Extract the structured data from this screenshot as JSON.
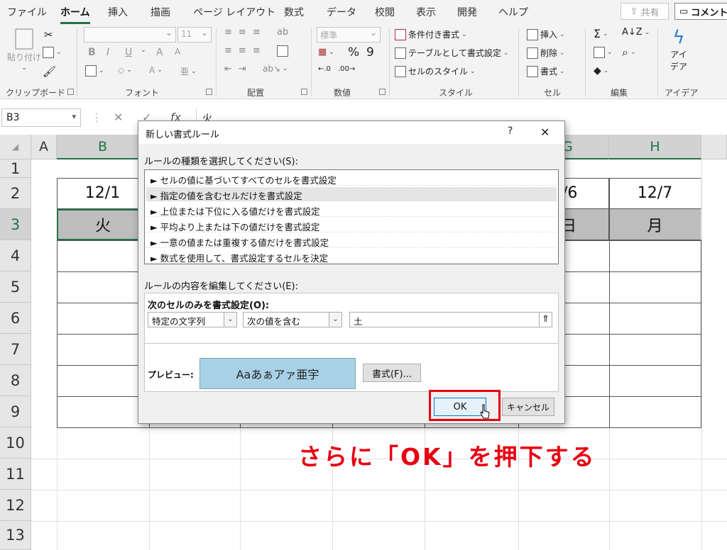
{
  "ribbon_tabs": [
    "ファイル",
    "ホーム",
    "挿入",
    "描画",
    "ページ レイアウト",
    "数式",
    "データ",
    "校閲",
    "表示",
    "開発",
    "ヘルプ"
  ],
  "share_label": "共有",
  "comment_label": "コメント",
  "clipboard": {
    "paste": "貼り付け",
    "group": "クリップボード"
  },
  "font": {
    "name_placeholder": "",
    "size": "11",
    "group": "フォント",
    "bold": "B",
    "italic": "I",
    "underline": "U"
  },
  "alignment": {
    "group": "配置"
  },
  "number": {
    "format": "標準",
    "group": "数値",
    "percent": "%",
    "comma": "9"
  },
  "styles": {
    "conditional": "条件付き書式",
    "table": "テーブルとして書式設定",
    "cell_styles": "セルのスタイル",
    "group": "スタイル"
  },
  "cells": {
    "insert": "挿入",
    "delete": "削除",
    "format": "書式",
    "group": "セル"
  },
  "editing": {
    "group": "編集"
  },
  "ideas": {
    "label1": "アイ",
    "label2": "デア",
    "group": "アイデア"
  },
  "formula_bar": {
    "name_box": "B3",
    "cancel": "✕",
    "confirm": "✓",
    "fx": "fx",
    "value": "火"
  },
  "columns": [
    "A",
    "B",
    "G",
    "H"
  ],
  "rows": [
    "1",
    "2",
    "3",
    "4",
    "5",
    "6",
    "7",
    "8",
    "9",
    "10",
    "11",
    "12",
    "13"
  ],
  "grid": {
    "b2": "12/1",
    "b3": "火",
    "g2": "/6",
    "g3": "日",
    "h2": "12/7",
    "h3": "月"
  },
  "dialog": {
    "title": "新しい書式ルール",
    "help": "?",
    "close": "✕",
    "type_label": "ルールの種類を選択してください(S):",
    "rules": [
      "► セルの値に基づいてすべてのセルを書式設定",
      "► 指定の値を含むセルだけを書式設定",
      "► 上位または下位に入る値だけを書式設定",
      "► 平均より上または下の値だけを書式設定",
      "► 一意の値または重複する値だけを書式設定",
      "► 数式を使用して、書式設定するセルを決定"
    ],
    "edit_label": "ルールの内容を編集してください(E):",
    "only_label": "次のセルのみを書式設定(O):",
    "condition1": "特定の文字列",
    "condition2": "次の値を含む",
    "value": "土",
    "preview_label": "プレビュー:",
    "preview_text": "Aaあぁアァ亜宇",
    "format_button": "書式(F)...",
    "ok": "OK",
    "cancel": "キャンセル"
  },
  "caption": "さらに「OK」を押下する",
  "colors": {
    "accent": "#217346",
    "highlight": "#e60012",
    "preview": "#a8d1e6"
  }
}
